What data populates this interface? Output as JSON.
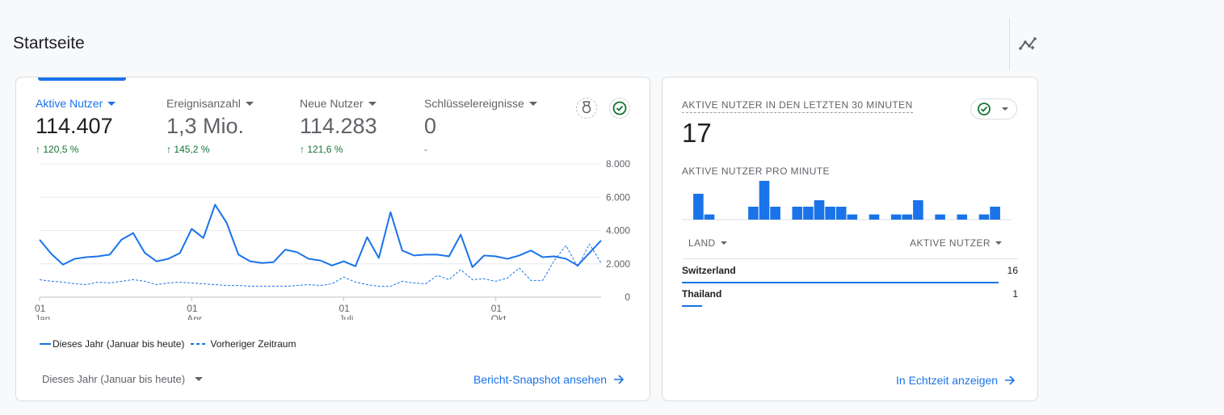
{
  "page": {
    "title": "Startseite"
  },
  "colors": {
    "accent": "#1a73e8",
    "positive": "#137333",
    "text": "#202124",
    "muted": "#5f6368"
  },
  "icons": {
    "insights": "insights-icon",
    "award": "award-icon",
    "check": "check-circle-icon",
    "arrow": "arrow-right-icon"
  },
  "main_card": {
    "metrics": [
      {
        "label": "Aktive Nutzer",
        "value": "114.407",
        "delta": "120,5 %",
        "active": true
      },
      {
        "label": "Ereignisanzahl",
        "value": "1,3 Mio.",
        "delta": "145,2 %",
        "active": false
      },
      {
        "label": "Neue Nutzer",
        "value": "114.283",
        "delta": "121,6 %",
        "active": false
      },
      {
        "label": "Schlüsselereignisse",
        "value": "0",
        "delta": "-",
        "active": false
      }
    ],
    "legend": {
      "current": "Dieses Jahr (Januar bis heute)",
      "previous": "Vorheriger Zeitraum"
    },
    "date_range": "Dieses Jahr (Januar bis heute)",
    "snapshot_link": "Bericht-Snapshot ansehen"
  },
  "chart_data": {
    "type": "line",
    "y_ticks": [
      "8.000",
      "6.000",
      "4.000",
      "2.000",
      "0"
    ],
    "ylim": [
      0,
      8000
    ],
    "x_ticks": [
      {
        "day": "01",
        "month": "Jan.",
        "index": 0
      },
      {
        "day": "01",
        "month": "Apr.",
        "index": 13
      },
      {
        "day": "01",
        "month": "Juli",
        "index": 26
      },
      {
        "day": "01",
        "month": "Okt.",
        "index": 39
      }
    ],
    "series": [
      {
        "name": "Dieses Jahr (Januar bis heute)",
        "style": "solid",
        "values": [
          3450,
          2600,
          1950,
          2300,
          2400,
          2450,
          2550,
          3450,
          3850,
          2650,
          2150,
          2300,
          2650,
          4100,
          3550,
          5550,
          4450,
          2550,
          2150,
          2050,
          2100,
          2850,
          2700,
          2300,
          2200,
          1900,
          2150,
          1850,
          3600,
          2350,
          5100,
          2800,
          2500,
          2550,
          2550,
          2450,
          3750,
          1800,
          2500,
          2450,
          2300,
          2500,
          2800,
          2400,
          2450,
          2300,
          1900,
          2650,
          3400
        ]
      },
      {
        "name": "Vorheriger Zeitraum",
        "style": "dashed",
        "values": [
          1050,
          950,
          900,
          800,
          750,
          900,
          850,
          950,
          1050,
          950,
          750,
          850,
          900,
          850,
          800,
          750,
          700,
          700,
          650,
          650,
          650,
          650,
          700,
          750,
          700,
          800,
          1200,
          900,
          750,
          650,
          650,
          950,
          850,
          800,
          1300,
          1050,
          1650,
          1050,
          1100,
          950,
          1150,
          1750,
          1000,
          1000,
          2200,
          3100,
          1800,
          3200,
          2050
        ]
      }
    ]
  },
  "realtime_card": {
    "title": "AKTIVE NUTZER IN DEN LETZTEN 30 MINUTEN",
    "value": "17",
    "subtitle": "AKTIVE NUTZER PRO MINUTE",
    "per_minute": [
      0,
      2,
      0.4,
      0,
      0,
      0,
      1,
      3,
      1,
      0,
      1,
      1,
      1.5,
      1,
      1,
      0.4,
      0,
      0.4,
      0,
      0.4,
      0.4,
      1.5,
      0,
      0.4,
      0,
      0.4,
      0,
      0.4,
      1,
      0
    ],
    "table": {
      "col_country": "LAND",
      "col_users": "AKTIVE NUTZER",
      "rows": [
        {
          "country": "Switzerland",
          "users": "16",
          "share": 1.0
        },
        {
          "country": "Thailand",
          "users": "1",
          "share": 0.0625
        }
      ]
    },
    "realtime_link": "In Echtzeit anzeigen"
  }
}
